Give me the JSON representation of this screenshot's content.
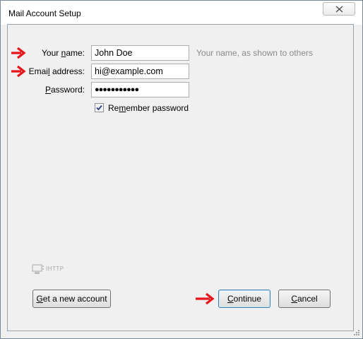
{
  "window": {
    "title": "Mail Account Setup",
    "close_icon": "close-icon"
  },
  "form": {
    "name": {
      "label_pre": "Your ",
      "label_u": "n",
      "label_post": "ame:",
      "value": "John Doe",
      "hint": "Your name, as shown to others"
    },
    "email": {
      "label_pre": "Emai",
      "label_u": "l",
      "label_post": " address:",
      "value": "hi@example.com"
    },
    "password": {
      "label_pre": "",
      "label_u": "P",
      "label_post": "assword:",
      "value": "●●●●●●●●●●●"
    },
    "remember": {
      "label_pre": "Re",
      "label_u": "m",
      "label_post": "ember password",
      "checked": true
    }
  },
  "protocol_badge": {
    "text": "IHTTP",
    "icon": "server-icon"
  },
  "buttons": {
    "new_account_u": "G",
    "new_account_post": "et a new account",
    "continue_u": "C",
    "continue_post": "ontinue",
    "cancel_pre": "",
    "cancel_u": "C",
    "cancel_post": "ancel"
  },
  "colors": {
    "arrow": "#e8141b",
    "hint": "#8a8a8a",
    "primary_border": "#3c7fb1"
  },
  "icons": {
    "arrow": "red-arrow-icon",
    "check": "checkmark-icon"
  }
}
